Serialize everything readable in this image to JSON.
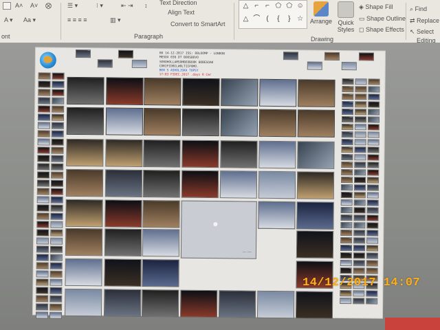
{
  "ribbon": {
    "groups": {
      "paragraph": "Paragraph",
      "drawing": "Drawing",
      "editing": "Editing",
      "font_fragment": "ont"
    },
    "paragraph": {
      "text_direction": "Text Direction",
      "align_text": "Align Text",
      "convert_smartart": "Convert to SmartArt"
    },
    "drawing": {
      "arrange": "Arrange",
      "quick_styles": "Quick Styles",
      "shape_fill": "Shape Fill",
      "shape_outline": "Shape Outline",
      "shape_effects": "Shape Effects"
    },
    "editing": {
      "find": "Find",
      "replace": "Replace",
      "select": "Select"
    },
    "shapes": [
      "△",
      "⌐",
      "⌐",
      "⬠",
      "⬠",
      "☺",
      "△",
      "⌒",
      "(",
      "{",
      "}",
      "☆"
    ]
  },
  "slide": {
    "text_lines": [
      "BU 14-12-2017 ISS: 88LOOMP - LONDON",
      "MESOX 036 DT BOOSBOVO",
      "SENOHOLLAMSOMBEOBOOK BOBESOAK",
      "CDBIFIDBILWOLTIIPOMO.",
      "BEN S ASHOLJSKA TOPSY",
      "17:03 FIDEC.2017 .days R Cmr"
    ],
    "text_colors": [
      "#3a3a3a",
      "#3a3a3a",
      "#3a3a3a",
      "#3a3a3a",
      "#2457c9",
      "#d12b2b"
    ],
    "moon_label": "--- ----"
  },
  "camera_stamp": {
    "date": "14/12/2017",
    "time": "14:07"
  },
  "colors": {
    "stamp": "#ffae16",
    "ribbon_bg": "#e9e7e0",
    "slide_bg": "#e7e6e2"
  }
}
